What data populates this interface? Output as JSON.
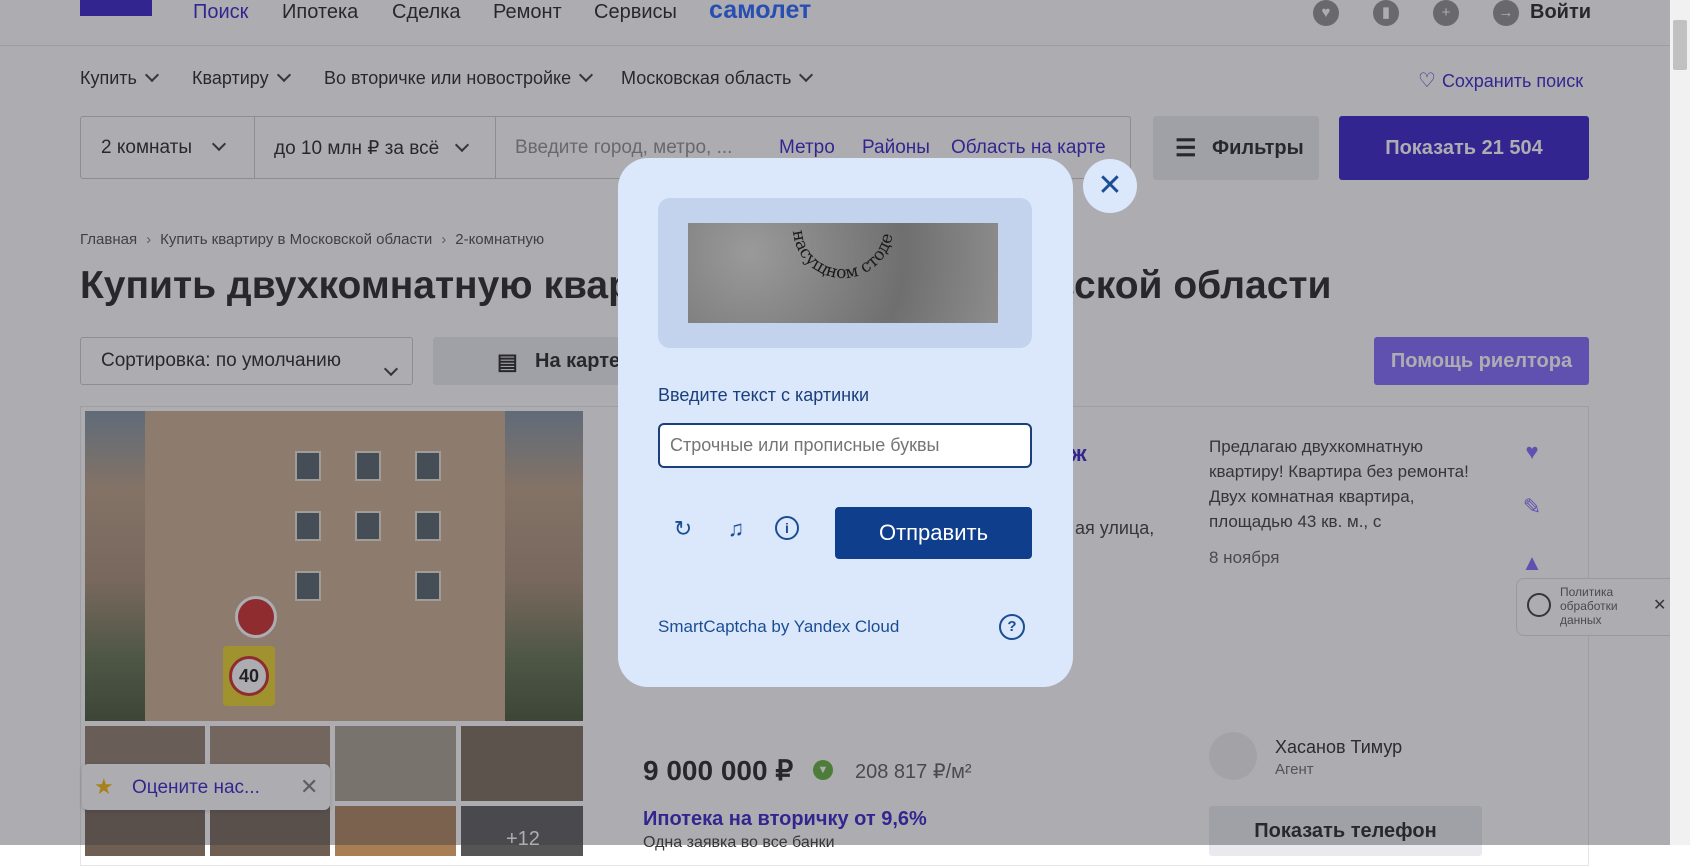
{
  "header": {
    "nav": [
      "Поиск",
      "Ипотека",
      "Сделка",
      "Ремонт",
      "Сервисы"
    ],
    "brand": "самолет",
    "login": "Войти"
  },
  "filters": {
    "buy": "Купить",
    "apartment": "Квартиру",
    "market": "Во вторичке или новостройке",
    "region": "Московская область",
    "save_search": "Сохранить поиск"
  },
  "searchbar": {
    "rooms": "2 комнаты",
    "price": "до 10 млн ₽ за всё",
    "placeholder": "Введите город, метро, ...",
    "links": [
      "Метро",
      "Районы",
      "Область на карте"
    ],
    "filters_btn": "Фильтры",
    "show_btn": "Показать 21 504"
  },
  "breadcrumbs": [
    "Главная",
    "Купить квартиру в Московской области",
    "2-комнатную"
  ],
  "page": {
    "title_left": "Купить двухкомнатную квар",
    "title_right": "вской области",
    "sort": "Сортировка: по умолчанию",
    "map": "На карте",
    "realtor": "Помощь риелтора"
  },
  "listing": {
    "title_frag": "ж",
    "street_frag": "ая улица,",
    "description": "Предлагаю двухкомнатную квартиру! Квартира без ремонта! Двух комнатная квартира, площадью 43 кв. м., с",
    "date": "8 ноября",
    "price": "9 000 000 ₽",
    "price_per_m2": "208 817 ₽/м²",
    "mortgage": "Ипотека на вторичку от 9,6%",
    "mortgage_sub": "Одна заявка во все банки",
    "agent_name": "Хасанов Тимур",
    "agent_role": "Агент",
    "phone_btn": "Показать телефон",
    "more_photos": "+12",
    "sign_speed": "40"
  },
  "widgets": {
    "rate": "Оцените нас...",
    "policy": "Политика обработки данных"
  },
  "captcha": {
    "image_text": "насущном стоде",
    "label": "Введите текст с картинки",
    "input_placeholder": "Строчные или прописные буквы",
    "submit": "Отправить",
    "footer": "SmartCaptcha by Yandex Cloud",
    "help": "?"
  },
  "colors": {
    "brand": "#2b16c5",
    "captcha_bg": "#dbe8fb",
    "captcha_button": "#0f3e8c"
  }
}
